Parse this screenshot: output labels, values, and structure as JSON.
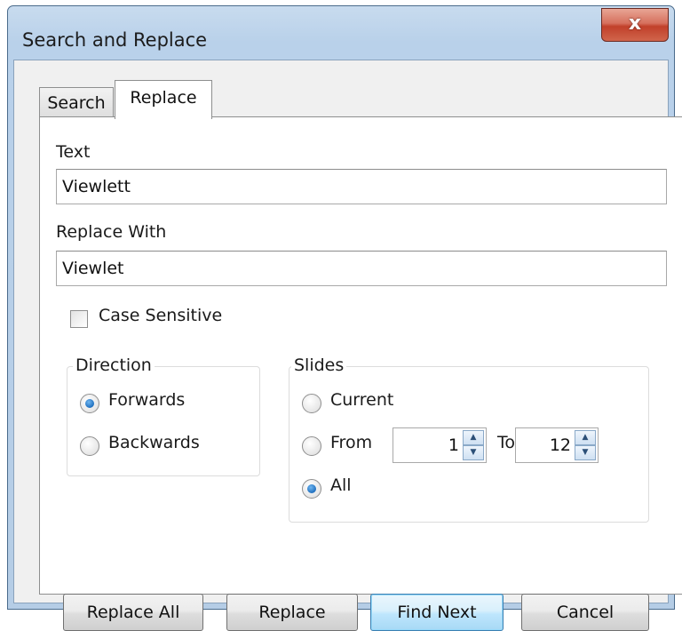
{
  "window": {
    "title": "Search and Replace",
    "close_glyph": "x"
  },
  "tabs": [
    {
      "label": "Search",
      "active": false
    },
    {
      "label": "Replace",
      "active": true
    }
  ],
  "text_field": {
    "label": "Text",
    "value": "Viewlett"
  },
  "replace_field": {
    "label": "Replace With",
    "value": "Viewlet"
  },
  "case_sensitive": {
    "label": "Case Sensitive",
    "checked": false
  },
  "direction": {
    "title": "Direction",
    "options": [
      {
        "label": "Forwards",
        "selected": true
      },
      {
        "label": "Backwards",
        "selected": false
      }
    ]
  },
  "slides": {
    "title": "Slides",
    "current_label": "Current",
    "from_label": "From",
    "from_value": "1",
    "to_label": "To",
    "to_value": "12",
    "all_label": "All",
    "selected": "All"
  },
  "buttons": {
    "replace_all": "Replace All",
    "replace": "Replace",
    "find_next": "Find Next",
    "cancel": "Cancel"
  },
  "icons": {
    "close": "close-icon",
    "spin_up": "chevron-up-icon",
    "spin_down": "chevron-down-icon"
  },
  "colors": {
    "title_bar": "#b9d1ea",
    "close_button": "#c1402a",
    "radio_selected": "#1f6fbf",
    "default_button": "#bee6fd"
  }
}
